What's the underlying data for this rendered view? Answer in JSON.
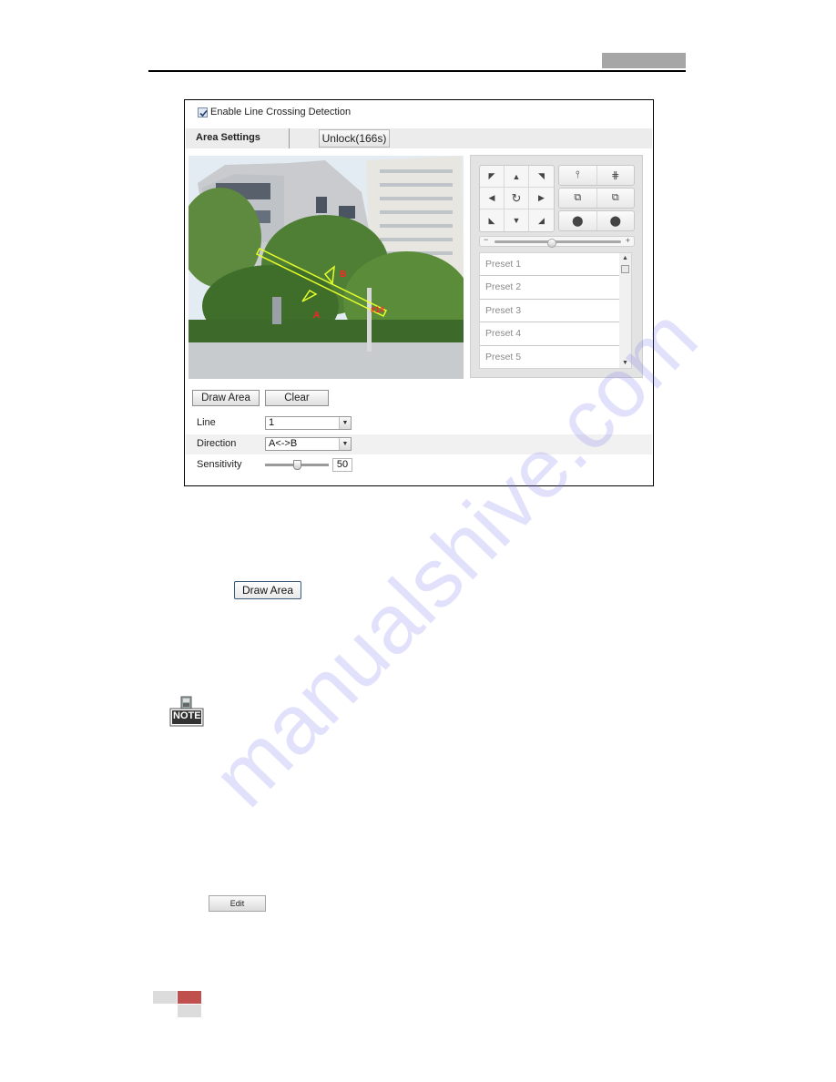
{
  "page": {
    "header_tab_color": "#a6a6a6",
    "footer_accent_color": "#c0504d",
    "watermark": "manualshive.com"
  },
  "ui_screenshot": {
    "enable_checkbox": {
      "label": "Enable Line Crossing Detection",
      "checked": true
    },
    "tabs": {
      "area_settings": "Area Settings",
      "unlock_button": "Unlock(166s)"
    },
    "video_overlay": {
      "label_a": "A",
      "label_b": "B",
      "line_id": "#1#"
    },
    "ptz": {
      "direction_icons": [
        "up-left-arrow-icon",
        "up-arrow-icon",
        "up-right-arrow-icon",
        "left-arrow-icon",
        "auto-pan-icon",
        "right-arrow-icon",
        "down-left-arrow-icon",
        "down-arrow-icon",
        "down-right-arrow-icon"
      ],
      "glyphs": {
        "up_left": "◤",
        "up": "▲",
        "up_right": "◥",
        "left": "◀",
        "auto": "↻",
        "right": "▶",
        "down_left": "◣",
        "down": "▼",
        "down_right": "◢"
      },
      "function_buttons": [
        {
          "name": "zoom-in-icon",
          "glyph": "⫯"
        },
        {
          "name": "zoom-out-icon",
          "glyph": "⋕"
        },
        {
          "name": "focus-near-icon",
          "glyph": "⧉"
        },
        {
          "name": "focus-far-icon",
          "glyph": "⧉"
        },
        {
          "name": "iris-open-icon",
          "glyph": "⬤"
        },
        {
          "name": "iris-close-icon",
          "glyph": "⬤"
        }
      ],
      "speed_slider": {
        "minus": "−",
        "plus": "+",
        "value_fraction": 0.45
      },
      "presets": [
        "Preset 1",
        "Preset 2",
        "Preset 3",
        "Preset 4",
        "Preset 5"
      ],
      "scroll_up": "▲",
      "scroll_down": "▼"
    },
    "buttons": {
      "draw_area": "Draw Area",
      "clear": "Clear"
    },
    "form": {
      "line": {
        "label": "Line",
        "value": "1"
      },
      "direction": {
        "label": "Direction",
        "value": "A<->B"
      },
      "sensitivity": {
        "label": "Sensitivity",
        "value": "50",
        "fraction": 0.5
      },
      "dropdown_arrow": "▼"
    }
  },
  "document": {
    "draw_area_button": "Draw Area",
    "note_icon_text": "NOTE",
    "edit_button": "Edit"
  }
}
